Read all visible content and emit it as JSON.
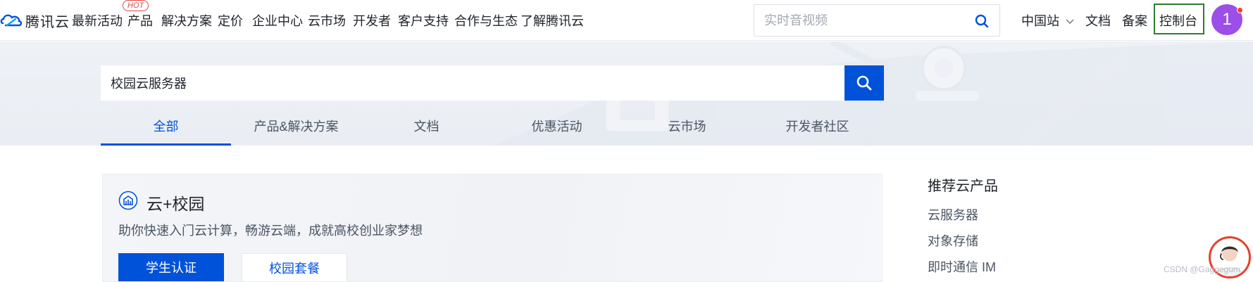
{
  "brand": {
    "name": "腾讯云"
  },
  "nav": {
    "items": [
      "最新活动",
      "产品",
      "解决方案",
      "定价",
      "企业中心",
      "云市场",
      "开发者",
      "客户支持",
      "合作与生态",
      "了解腾讯云"
    ],
    "hot_badge": "HOT",
    "search_placeholder": "实时音视频",
    "region": "中国站",
    "docs": "文档",
    "filing": "备案",
    "console": "控制台",
    "avatar_initial": "1"
  },
  "search": {
    "query": "校园云服务器"
  },
  "tabs": [
    "全部",
    "产品&解决方案",
    "文档",
    "优惠活动",
    "云市场",
    "开发者社区"
  ],
  "active_tab": "全部",
  "card": {
    "title": "云+校园",
    "desc": "助你快速入门云计算，畅游云端，成就高校创业家梦想",
    "primary_btn": "学生认证",
    "secondary_btn": "校园套餐"
  },
  "recommend": {
    "title": "推荐云产品",
    "items": [
      "云服务器",
      "对象存储",
      "即时通信 IM"
    ]
  },
  "watermark": "CSDN @Gaggegum",
  "colors": {
    "primary": "#0052d9",
    "avatar": "#9b4fe6",
    "console_outline": "#2e7d32",
    "hot": "#e54545"
  }
}
